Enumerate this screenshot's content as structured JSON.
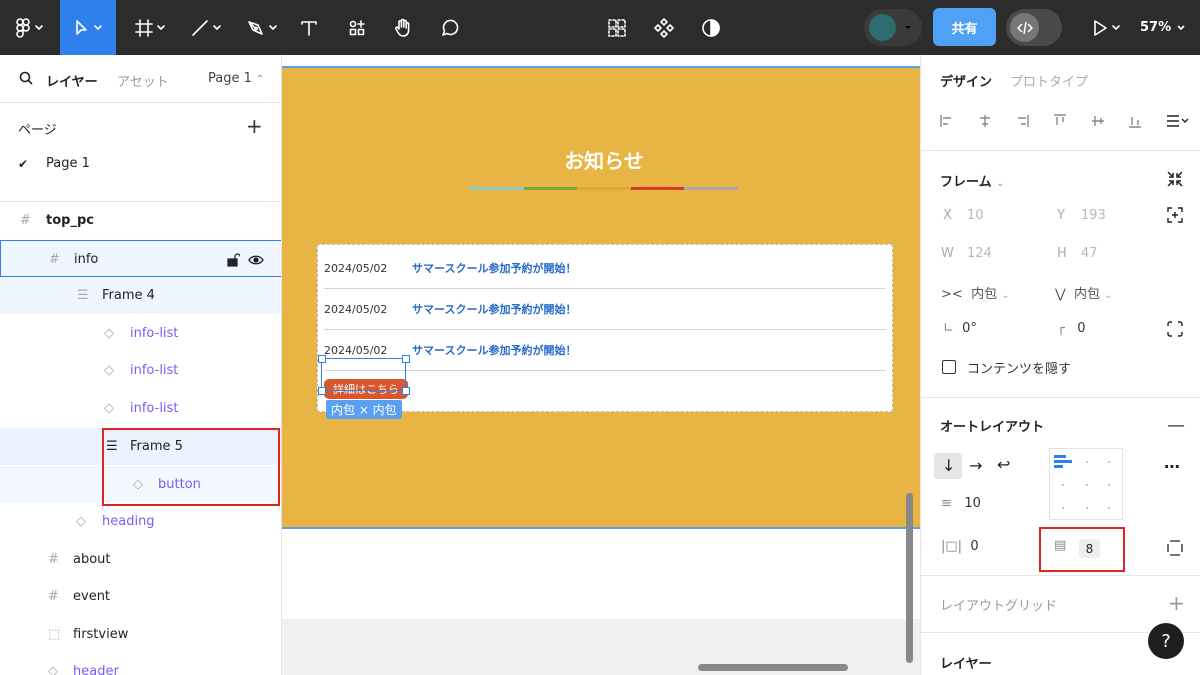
{
  "toolbar": {
    "share_label": "共有",
    "zoom": "57%"
  },
  "left_panel": {
    "tab_layers": "レイヤー",
    "tab_assets": "アセット",
    "page_selector": "Page 1",
    "pages_header": "ページ",
    "pages": [
      "Page 1"
    ],
    "layers": [
      {
        "name": "top_pc",
        "type": "frame"
      },
      {
        "name": "info",
        "type": "frame"
      },
      {
        "name": "Frame 4",
        "type": "autolayout"
      },
      {
        "name": "info-list",
        "type": "instance"
      },
      {
        "name": "info-list",
        "type": "instance"
      },
      {
        "name": "info-list",
        "type": "instance"
      },
      {
        "name": "Frame 5",
        "type": "autolayout"
      },
      {
        "name": "button",
        "type": "instance"
      },
      {
        "name": "heading",
        "type": "instance"
      },
      {
        "name": "about",
        "type": "frame"
      },
      {
        "name": "event",
        "type": "frame"
      },
      {
        "name": "firstview",
        "type": "section"
      },
      {
        "name": "header",
        "type": "instance"
      }
    ]
  },
  "canvas": {
    "title": "お知らせ",
    "rainbow_colors": [
      "#8cc7c9",
      "#7aa83a",
      "#e0a73a",
      "#d93a2b",
      "#a8a8a8"
    ],
    "news": [
      {
        "date": "2024/05/02",
        "text": "サマースクール参加予約が開始！"
      },
      {
        "date": "2024/05/02",
        "text": "サマースクール参加予約が開始！"
      },
      {
        "date": "2024/05/02",
        "text": "サマースクール参加予約が開始！"
      }
    ],
    "button_label": "詳細はこちら",
    "hug_label": "内包 × 内包"
  },
  "right_panel": {
    "tab_design": "デザイン",
    "tab_prototype": "プロトタイプ",
    "frame": {
      "title": "フレーム",
      "x_label": "X",
      "x": "10",
      "y_label": "Y",
      "y": "193",
      "w_label": "W",
      "w": "124",
      "h_label": "H",
      "h": "47",
      "width_mode": "内包",
      "height_mode": "内包",
      "rotation": "0°",
      "radius": "0",
      "clip_label": "コンテンツを隠す"
    },
    "autolayout": {
      "title": "オートレイアウト",
      "gap": "10",
      "horizontal_padding": "0",
      "vertical_padding": "8"
    },
    "layout_grid": "レイアウトグリッド",
    "layer_section": "レイヤー"
  }
}
